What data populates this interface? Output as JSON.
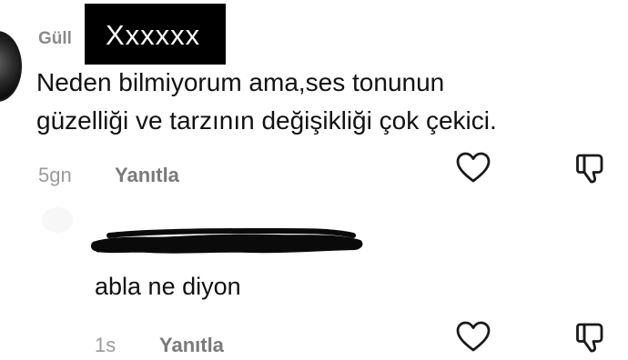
{
  "comment": {
    "username": "Güll",
    "redacted_label": "Xxxxxx",
    "text_lines": [
      "Neden bilmiyorum ama,ses tonunun",
      "güzelliği ve tarzının değişikliği çok çekici."
    ],
    "time": "5gn",
    "reply_label": "Yanıtla"
  },
  "reply": {
    "text": "abla ne diyon",
    "time": "1s",
    "reply_label": "Yanıtla"
  },
  "icons": {
    "like": "heart-icon",
    "dislike": "thumbs-down-icon",
    "stroke_color": "#1a1a1a"
  },
  "colors": {
    "username": "#8a8a8a",
    "meta_time": "#9a9a9a",
    "meta_reply": "#7a7a7a",
    "redaction": "#000000"
  }
}
